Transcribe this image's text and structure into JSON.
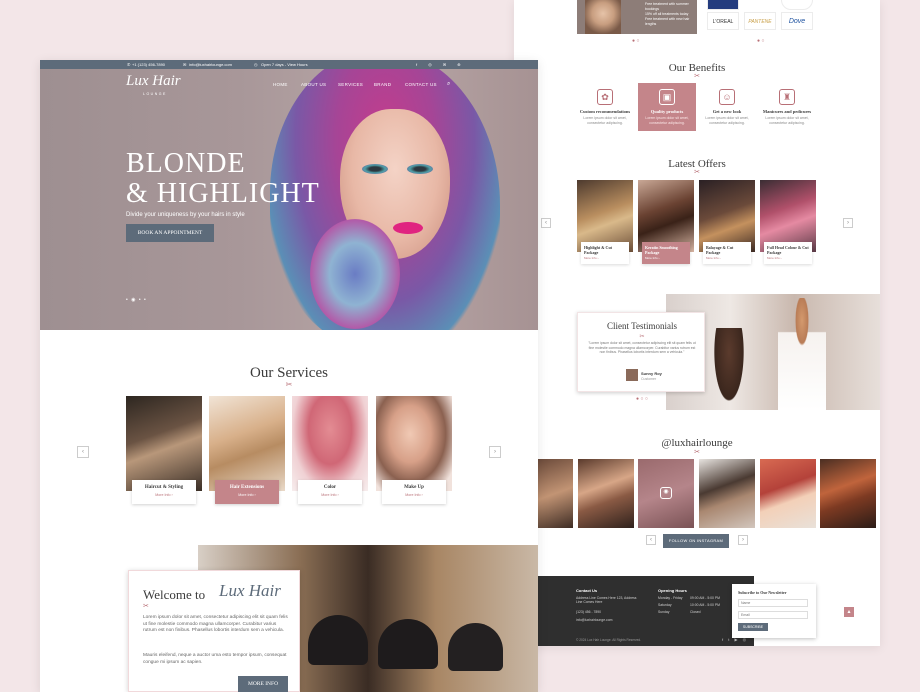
{
  "right": {
    "top_list": [
      "Free treatment with summer bookings",
      "15% off all treatments today",
      "Free treatment with new hair lengths"
    ],
    "brands": [
      "L'OREAL",
      "PANTENE",
      "Dove"
    ],
    "benefits_title": "Our Benefits",
    "benefits": [
      {
        "title": "Custom recommendations",
        "desc": "Lorem ipsum dolor sit amet, consectetur adipiscing.",
        "icon": "gift-icon"
      },
      {
        "title": "Quality products",
        "desc": "Lorem ipsum dolor sit amet, consectetur adipiscing.",
        "icon": "box-icon"
      },
      {
        "title": "Get a new look",
        "desc": "Lorem ipsum dolor sit amet, consectetur adipiscing.",
        "icon": "person-icon"
      },
      {
        "title": "Manicures and pedicures",
        "desc": "Lorem ipsum dolor sit amet, consectetur adipiscing.",
        "icon": "bottle-icon"
      }
    ],
    "offers_title": "Latest Offers",
    "offers": [
      {
        "title": "Highlight & Cut Package",
        "more": "More Info ›"
      },
      {
        "title": "Keratin Smoothing Package",
        "more": "More Info ›"
      },
      {
        "title": "Balayage & Cut Package",
        "more": "More Info ›"
      },
      {
        "title": "Full Head Colour & Cut Package",
        "more": "More Info ›"
      }
    ],
    "testimonials_title": "Client Testimonials",
    "testimonial_text": "\"Lorem ipsum dolor sit amet, consectetur adipiscing elit sit quam felis ut fine molestie commodo magna ullamcorper. Curabitur varius rutrum est non finibus. Phasellus lobortis interdum sem a vehicula.\"",
    "testimonial_name": "Sunny Roy",
    "testimonial_role": "Customer",
    "instagram_handle": "@luxhairlounge",
    "follow_label": "FOLLOW ON INSTAGRAM",
    "footer": {
      "contact_title": "Contact Us",
      "address": "Address Line Comes Here 123, Address Line Comes Here",
      "phone": "(123) 456 - 7890",
      "email": "info@luxhairlounge.com",
      "hours_title": "Opening Hours",
      "hours": [
        {
          "day": "Monday - Friday",
          "time": "09:00 AM - 5:00 PM"
        },
        {
          "day": "Saturday",
          "time": "10:00 AM - 5:00 PM"
        },
        {
          "day": "Sunday",
          "time": "Closed"
        }
      ],
      "copyright": "© 2024 Lux Hair Lounge. All Rights Reserved.",
      "newsletter_title": "Subscribe to Our Newsletter",
      "name_placeholder": "Name",
      "email_placeholder": "Email",
      "subscribe_label": "SUBSCRIBE"
    }
  },
  "left": {
    "topbar": {
      "phone": "+1 (123) 456-7890",
      "email": "info@luxhairlounge.com",
      "hours": "Open 7 days - View Hours"
    },
    "logo_main": "Lux Hair",
    "logo_sub": "LOUNGE",
    "nav": [
      "HOME",
      "ABOUT US",
      "SERVICES",
      "BRAND",
      "CONTACT US"
    ],
    "hero_title_1": "BLONDE",
    "hero_title_2": "& HIGHLIGHT",
    "hero_subtitle": "Divide your uniqueness by your hairs in style",
    "hero_button": "BOOK AN APPOINTMENT",
    "services_title": "Our Services",
    "services": [
      {
        "title": "Haircut & Styling",
        "more": "More Info ›"
      },
      {
        "title": "Hair Extensions",
        "more": "More Info ›"
      },
      {
        "title": "Color",
        "more": "More Info ›"
      },
      {
        "title": "Make Up",
        "more": "More Info ›"
      }
    ],
    "welcome_prefix": "Welcome to",
    "welcome_brand": "Lux Hair",
    "welcome_p1": "Lorem ipsum dolor sit amet, consectetur adipiscing elit sit quam felis ut fine molestie commodo magna ullamcorper. Curabitur varius rutrum est non finibus. Phasellus lobortis interdum sem a vehicula.",
    "welcome_p2": "Mauris eleifend, neque a auctor uma esto tempor ipsum, consequat congue mi ipsum ac sapien.",
    "more_info": "MORE INFO"
  }
}
